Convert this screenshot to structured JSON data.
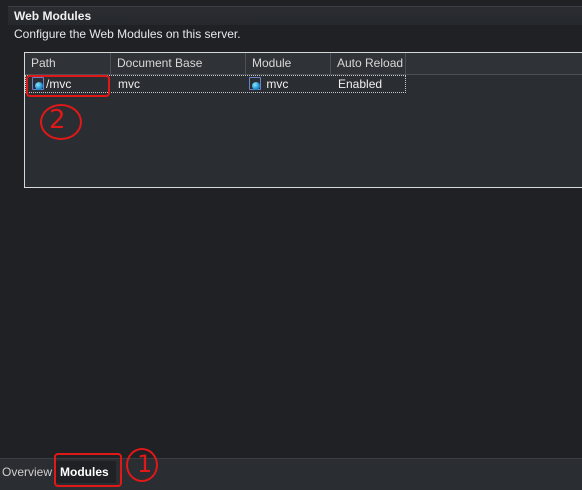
{
  "section": {
    "title": "Web Modules",
    "description": "Configure the Web Modules on this server."
  },
  "table": {
    "columns": [
      "Path",
      "Document Base",
      "Module",
      "Auto Reload"
    ],
    "rows": [
      {
        "path": "/mvc",
        "document_base": "mvc",
        "module": "mvc",
        "auto_reload": "Enabled",
        "path_icon": "web-module-icon",
        "module_icon": "web-module-icon"
      }
    ]
  },
  "tabs": {
    "items": [
      {
        "label": "Overview",
        "selected": false
      },
      {
        "label": "Modules",
        "selected": true
      }
    ]
  },
  "annotations": {
    "marker_1": "1",
    "marker_2": "2",
    "color": "#e01818"
  },
  "colors": {
    "background": "#1f2124",
    "table_border": "#d8d8d8",
    "text": "#e6e6e6"
  }
}
